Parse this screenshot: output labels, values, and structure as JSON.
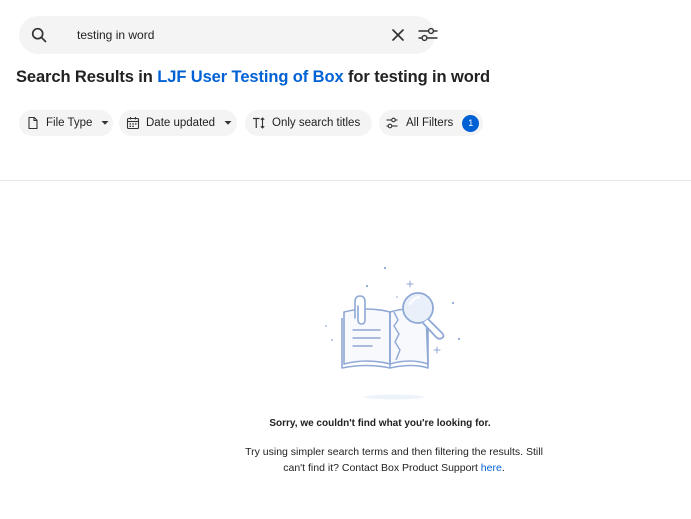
{
  "search": {
    "value": "testing in word",
    "icon": "search-icon",
    "clear_icon": "close-icon",
    "options_icon": "sliders-icon"
  },
  "heading": {
    "prefix": "Search Results in ",
    "folder": "LJF User Testing of Box",
    "middle": " for ",
    "query": "testing in word"
  },
  "filters": {
    "file_type": {
      "label": "File Type",
      "icon": "file-icon"
    },
    "date_updated": {
      "label": "Date updated",
      "icon": "calendar-icon"
    },
    "only_titles": {
      "label": "Only search titles",
      "icon": "text-size-icon"
    },
    "all_filters": {
      "label": "All Filters",
      "icon": "sliders-icon",
      "count": "1"
    }
  },
  "empty_state": {
    "title": "Sorry, we couldn't find what you're looking for.",
    "body": "Try using simpler search terms and then filtering the results. Still can't find it? Contact Box Product Support",
    "link": "here",
    "suffix": "."
  },
  "colors": {
    "accent": "#0061d5",
    "pill_bg": "#f4f4f4",
    "text": "#222222",
    "illustration": "#8fa8d6"
  }
}
